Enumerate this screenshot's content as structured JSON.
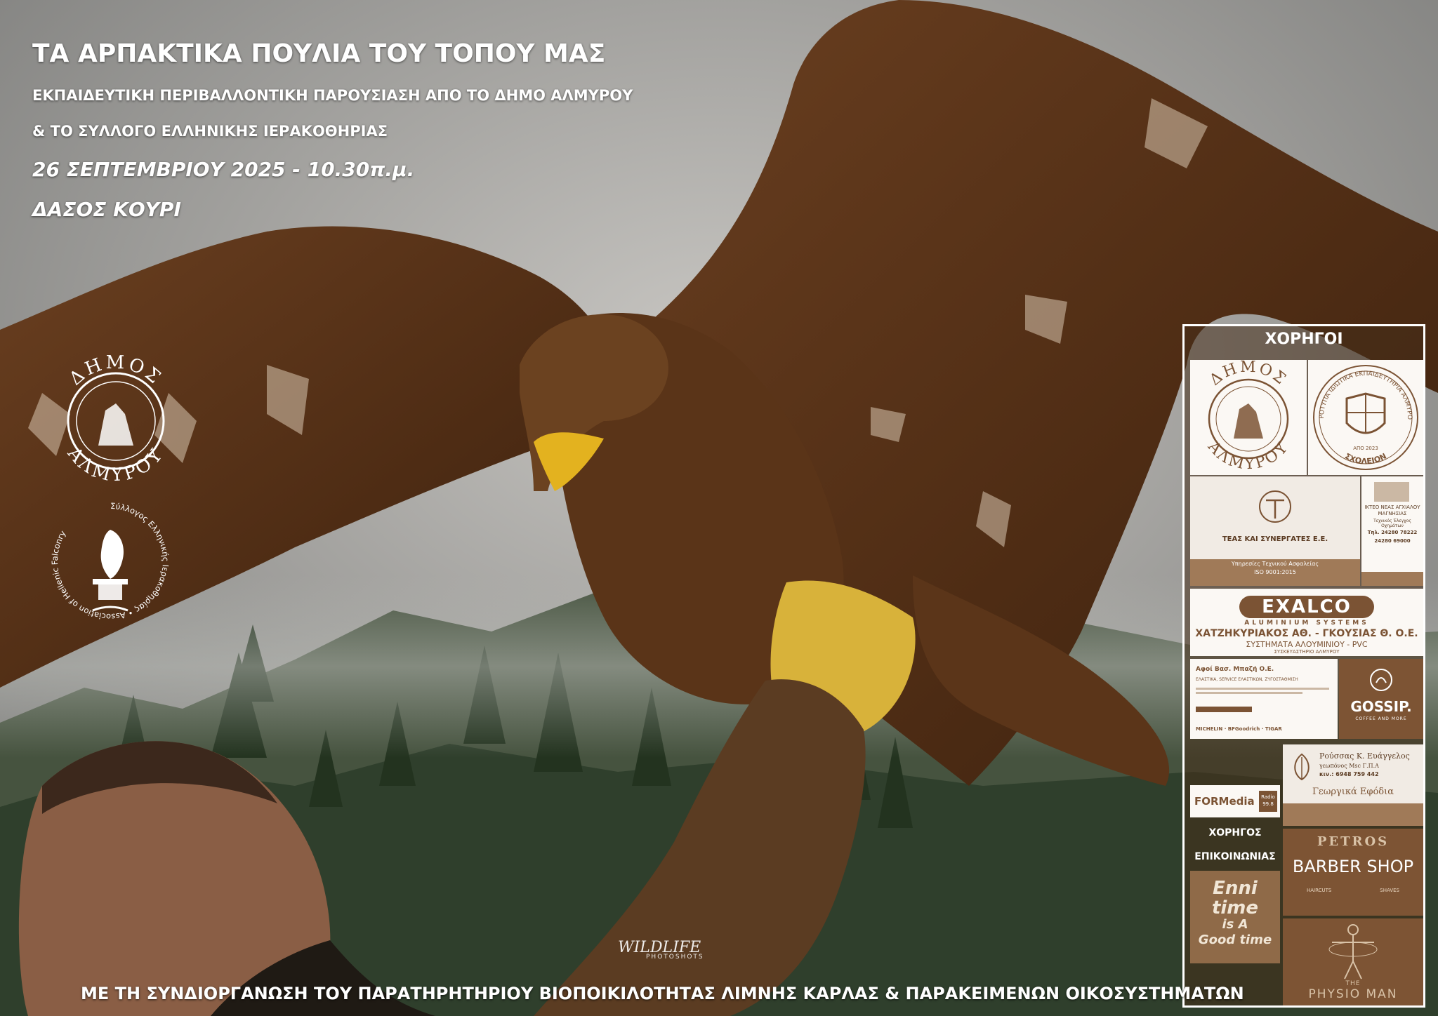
{
  "header": {
    "title": "ΤΑ ΑΡΠΑΚΤΙΚΑ ΠΟΥΛΙΑ ΤΟΥ ΤΟΠΟΥ ΜΑΣ",
    "subtitle_line1": "ΕΚΠΑΙΔΕΥΤΙΚΗ ΠΕΡΙΒΑΛΛΟΝΤΙΚΗ ΠΑΡΟΥΣΙΑΣΗ ΑΠΟ ΤΟ ΔΗΜΟ ΑΛΜΥΡΟΥ",
    "subtitle_line2": "& ΤΟ ΣΥΛΛΟΓΟ ΕΛΛΗΝΙΚΗΣ ΙΕΡΑΚΟΘΗΡΙΑΣ",
    "date": "26 ΣΕΠΤΕΜΒΡΙΟΥ 2025 - 10.30π.μ.",
    "place": "ΔΑΣΟΣ ΚΟΥΡΙ"
  },
  "logos": {
    "municipality_top": "ΔΗΜΟΣ",
    "municipality_bottom": "ΑΛΜΥΡΟΥ",
    "falconry_ring": "Σύλλογος Ελληνικής Ιερακοθηρίας • Association of Hellenic Falconry"
  },
  "footer": {
    "text": "ΜΕ ΤΗ ΣΥΝΔΙΟΡΓΑΝΩΣΗ ΤΟΥ ΠΑΡΑΤΗΡΗΤΗΡΙΟΥ ΒΙΟΠΟΙΚΙΛΟΤΗΤΑΣ ΛΙΜΝΗΣ ΚΑΡΛΑΣ & ΠΑΡΑΚΕΙΜΕΝΩΝ ΟΙΚΟΣΥΣΤΗΜΑΤΩΝ"
  },
  "watermark": {
    "line1": "WILDLIFE",
    "line2": "PHOTOSHOTS"
  },
  "sponsors": {
    "title": "ΧΟΡΗΓΟΙ",
    "dimos_top": "ΔΗΜΟΣ",
    "dimos_bottom": "ΑΛΜΥΡΟΥ",
    "school_ring": "ΠΡΟΤΥΠΑ ΙΔΙΩΤΙΚΑ ΕΚΠΑΙΔΕΥΤΗΡΙΑ ΑΛΜΥΡΟΥ",
    "school_bottom": "ΣΧΟΛΕΙΟΝ",
    "school_year": "ΑΠΟ 2023",
    "teas_name": "ΤΕΑΣ ΚΑΙ ΣΥΝΕΡΓΑΤΕΣ Ε.Ε.",
    "teas_service": "Υπηρεσίες Τεχνικού Ασφαλείας",
    "teas_iso": "ISO 9001:2015",
    "kteo_name": "ΙΚΤΕΟ ΝΕΑΣ ΑΓΧΙΑΛΟΥ ΜΑΓΝΗΣΙΑΣ",
    "kteo_sub": "Τεχνικός Έλεγχος Οχημάτων",
    "kteo_phone1": "Τηλ. 24280 78222",
    "kteo_phone2": "24280 69000",
    "exalco_brand": "EXALCO",
    "exalco_sub": "ALUMINIUM SYSTEMS",
    "exalco_partner": "ΧΑΤΖΗΚΥΡΙΑΚΟΣ ΑΘ. - ΓΚΟΥΣΙΑΣ Θ. Ο.Ε.",
    "exalco_systems": "ΣΥΣΤΗΜΑΤΑ ΑΛΟΥΜΙΝΙΟΥ - PVC",
    "exalco_location": "ΣΥΣΚΕΥΑΣΤΗΡΙΟ ΑΛΜΥΡΟΥ",
    "bazis_name": "Αφοί Βασ. Μπαζή Ο.Ε.",
    "bazis_services": "ΕΛΑΣΤΙΚΑ, SERVICE ΕΛΑΣΤΙΚΩΝ, ΖΥΓΟΣΤΑΘΜΙΣΗ",
    "bazis_brands": "MICHELIN · BFGoodrich · TIGAR",
    "gossip_name": "GOSSIP.",
    "gossip_sub": "COFFEE AND MORE",
    "rousas_name": "Ρούσσας Κ. Ευάγγελος",
    "rousas_sub": "γεωπόνος Msc Γ.Π.Α",
    "rousas_phone": "κιν.: 6948 759 442",
    "rousas_product": "Γεωργικά Εφόδια",
    "formedia_name": "FORMedia",
    "formedia_radio": "Radio 99.8",
    "comm_label1": "ΧΟΡΗΓΟΣ",
    "comm_label2": "ΕΠΙΚΟΙΝΩΝΙΑΣ",
    "enni_line1": "Enni",
    "enni_line2": "time",
    "enni_line3": "is A",
    "enni_line4": "Good time",
    "petros_top": "PETROS",
    "petros_main": "BARBER SHOP",
    "petros_left": "HAIRCUTS",
    "petros_right": "SHAVES",
    "physio_top": "THE",
    "physio_main": "PHYSIO MAN"
  }
}
